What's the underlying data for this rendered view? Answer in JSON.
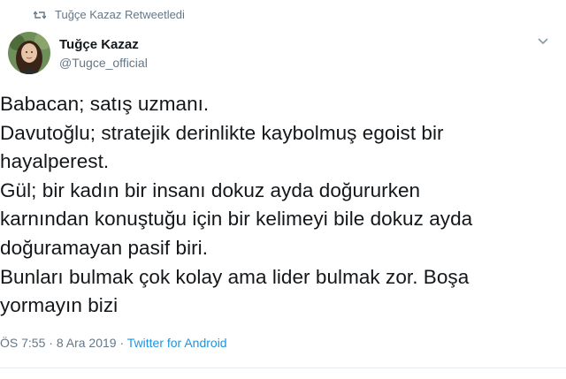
{
  "retweet": {
    "label": "Tuğçe Kazaz Retweetledi",
    "icon": "retweet-icon"
  },
  "author": {
    "display_name": "Tuğçe Kazaz",
    "handle": "@Tugce_official",
    "avatar": "avatar"
  },
  "menu_icon": "chevron-down-icon",
  "tweet": {
    "lines": [
      "Babacan; satış uzmanı.",
      "Davutoğlu; stratejik derinlikte kaybolmuş egoist bir",
      "hayalperest.",
      "Gül; bir kadın bir insanı dokuz ayda doğururken",
      "karnından konuştuğu için bir kelimeyi bile dokuz ayda",
      "doğuramayan pasif biri.",
      "Bunları bulmak çok kolay ama lider bulmak zor. Boşa",
      "yormayın bizi"
    ]
  },
  "meta": {
    "time": "ÖS 7:55",
    "separator1": "·",
    "date": "8 Ara 2019",
    "separator2": "·",
    "source": "Twitter for Android"
  },
  "colors": {
    "text": "#14171a",
    "secondary": "#657786",
    "link": "#1b95e0"
  }
}
